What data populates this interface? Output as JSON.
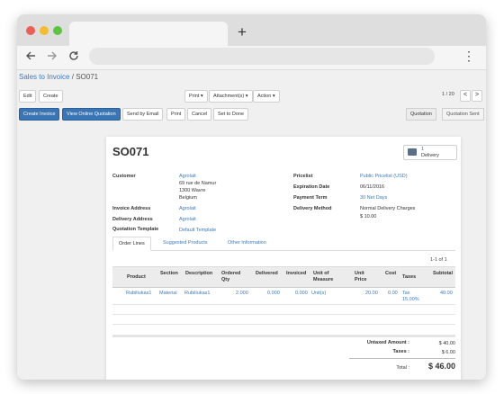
{
  "browser": {
    "new_tab_symbol": "+",
    "nav_icons": [
      "back-arrow",
      "forward-arrow",
      "reload"
    ],
    "menu_symbol": "⋮"
  },
  "breadcrumb": {
    "parent": "Sales to Invoice",
    "separator": "/",
    "current": "SO071"
  },
  "toolbar": {
    "edit": "Edit",
    "create": "Create",
    "print": "Print ▾",
    "attachments": "Attachment(s) ▾",
    "action": "Action ▾",
    "pager": "1 / 20",
    "prev": "<",
    "next": ">"
  },
  "statusbar_buttons": {
    "create_invoice": "Create Invoice",
    "view_online_quotation": "View Online Quotation",
    "send_by_email": "Send by Email",
    "print": "Print",
    "cancel": "Cancel",
    "set_to_done": "Set to Done"
  },
  "stages": [
    "Quotation",
    "Quotation Sent"
  ],
  "sheet": {
    "title": "SO071",
    "smart_button": {
      "value": "1",
      "label": "Delivery"
    },
    "left_fields": {
      "customer_label": "Customer",
      "customer_name": "Agrolait",
      "customer_addr1": "69 rue de Namur",
      "customer_addr2": "1300 Wavre",
      "customer_addr3": "Belgium",
      "invoice_address_label": "Invoice Address",
      "invoice_address": "Agrolait",
      "delivery_address_label": "Delivery Address",
      "delivery_address": "Agrolait",
      "quotation_template_label": "Quotation Template",
      "quotation_template": "Default Template"
    },
    "right_fields": {
      "pricelist_label": "Pricelist",
      "pricelist": "Public Pricelist (USD)",
      "expiration_label": "Expiration Date",
      "expiration": "06/11/2016",
      "payment_term_label": "Payment Term",
      "payment_term": "30 Net Days",
      "delivery_method_label": "Delivery Method",
      "delivery_method": "Normal Delivery Charges",
      "delivery_method_price": "$ 10.00"
    },
    "tabs": [
      "Order Lines",
      "Suggested Products",
      "Other Information"
    ],
    "page_info": "1-1 of 1",
    "table": {
      "headers": {
        "product": "Product",
        "section": "Section",
        "description": "Description",
        "ordered_qty_1": "Ordered",
        "ordered_qty_2": "Qty",
        "delivered": "Delivered",
        "invoiced": "Invoiced",
        "uom_1": "Unit of",
        "uom_2": "Measure",
        "unit_price_1": "Unit",
        "unit_price_2": "Price",
        "cost": "Cost",
        "taxes": "Taxes",
        "subtotal": "Subtotal"
      },
      "row": {
        "product": "Rubiliukas1",
        "section": "Material",
        "description": "Rubiliukas1",
        "ordered_qty": "2.000",
        "delivered": "0.000",
        "invoiced": "0.000",
        "uom": "Unit(s)",
        "unit_price": "20.00",
        "cost": "0.00",
        "taxes_1": "Tax",
        "taxes_2": "15.00%",
        "subtotal": "40.00"
      }
    },
    "totals": {
      "untaxed_label": "Untaxed Amount :",
      "untaxed_value": "$ 40.00",
      "taxes_label": "Taxes :",
      "taxes_value": "$ 6.00",
      "total_label": "Total :",
      "total_value": "$ 46.00"
    }
  },
  "colors": {
    "primary_button": "#3a75b5",
    "link": "#3a7bbf",
    "close_dot": "#ec5f57",
    "minimize_dot": "#f3bd2e",
    "zoom_dot": "#5cc43f"
  }
}
